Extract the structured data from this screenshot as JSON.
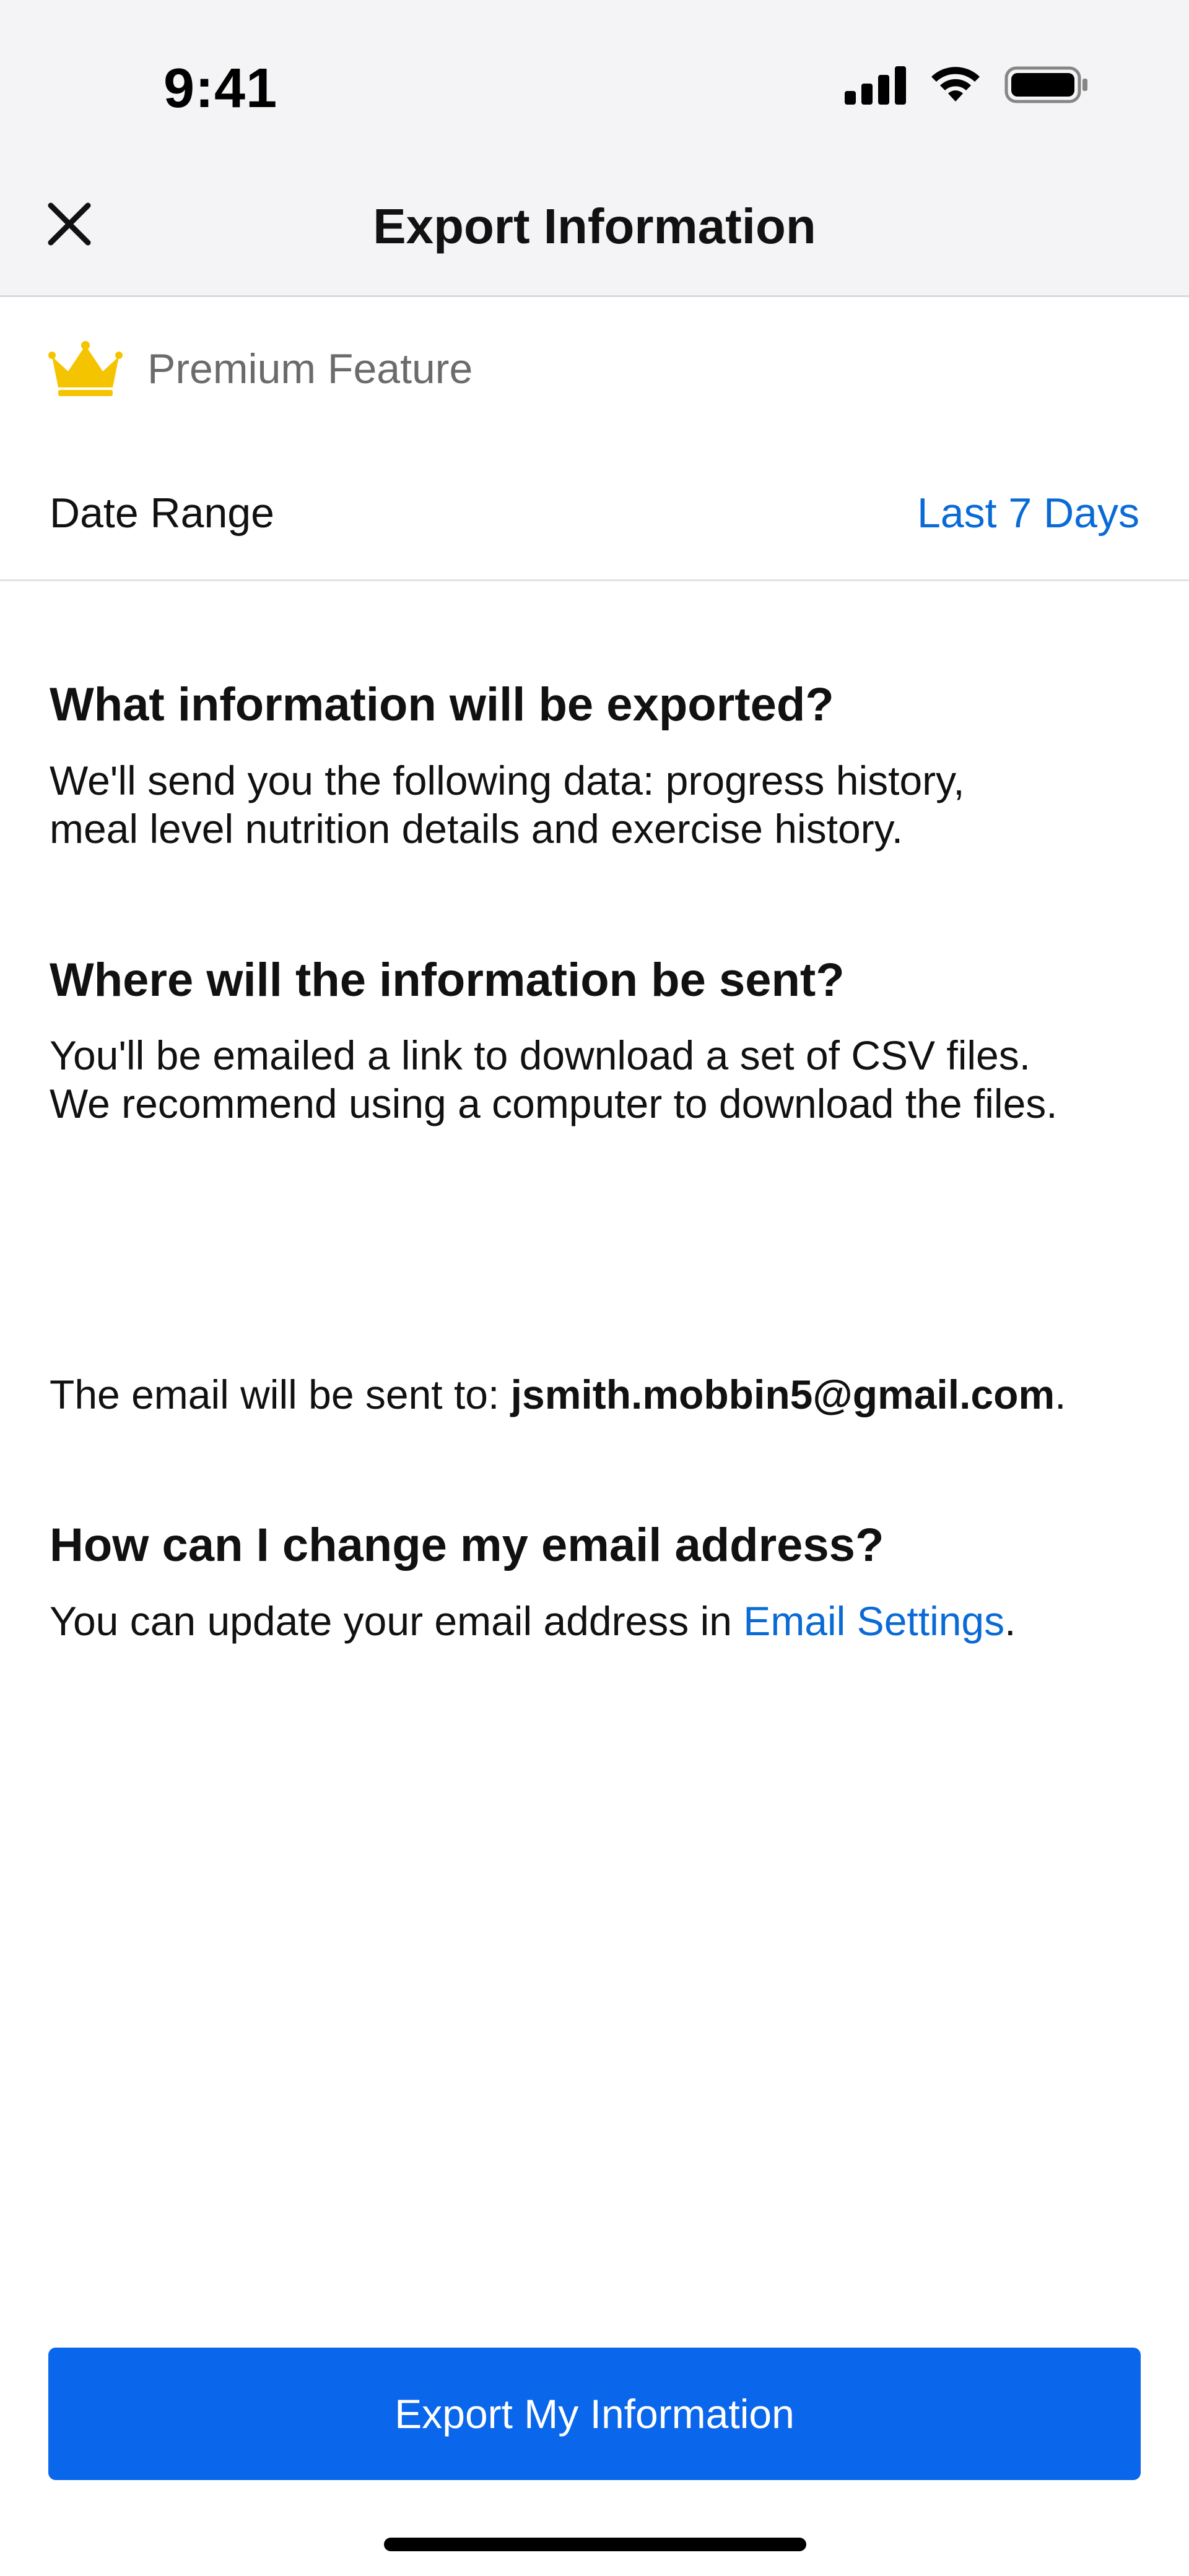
{
  "status_bar": {
    "time": "9:41",
    "icons": [
      "cellular-signal-icon",
      "wifi-icon",
      "battery-icon"
    ]
  },
  "nav": {
    "close_icon": "close-icon",
    "title": "Export Information"
  },
  "premium": {
    "icon": "crown-icon",
    "label": "Premium Feature",
    "icon_color": "#F5C400"
  },
  "date_range": {
    "label": "Date Range",
    "value": "Last 7 Days"
  },
  "sections": {
    "what": {
      "heading": "What information will be exported?",
      "body_line1": "We'll send you the following data: progress history,",
      "body_line2": "meal level nutrition details and exercise history."
    },
    "where": {
      "heading": "Where will the information be sent?",
      "body_line1": "You'll be emailed a link to download a set of CSV files.",
      "body_line2": "We recommend using a computer to download the files."
    },
    "email": {
      "prefix": "The email will be sent to: ",
      "address": "jsmith.mobbin5@gmail.com",
      "suffix": "."
    },
    "change": {
      "heading": "How can I change my email address?",
      "body_prefix": "You can update your email address in ",
      "link_label": "Email Settings",
      "body_suffix": "."
    }
  },
  "export_button": {
    "label": "Export My Information"
  },
  "colors": {
    "accent": "#0A6AD6",
    "button": "#0A66EA",
    "header_bg": "#F4F4F6"
  }
}
